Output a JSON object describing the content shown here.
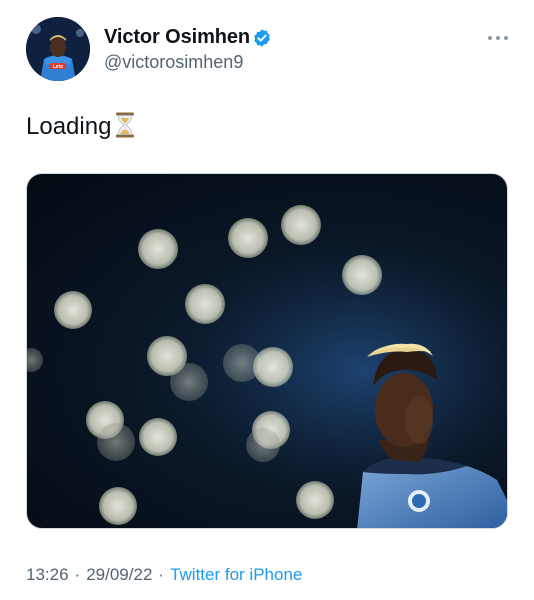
{
  "author": {
    "display_name": "Victor Osimhen",
    "handle": "@victorosimhen9",
    "verified": true,
    "avatar_shirt_text": "Lete"
  },
  "tweet": {
    "text": "Loading",
    "emoji_icon": "hourglass-icon"
  },
  "media": {
    "description_icon": "photo"
  },
  "meta": {
    "time": "13:26",
    "separator": "·",
    "date": "29/09/22",
    "source": "Twitter for iPhone"
  },
  "colors": {
    "link": "#1d9bf0",
    "verified": "#1d9bf0",
    "secondary_text": "#536471"
  }
}
